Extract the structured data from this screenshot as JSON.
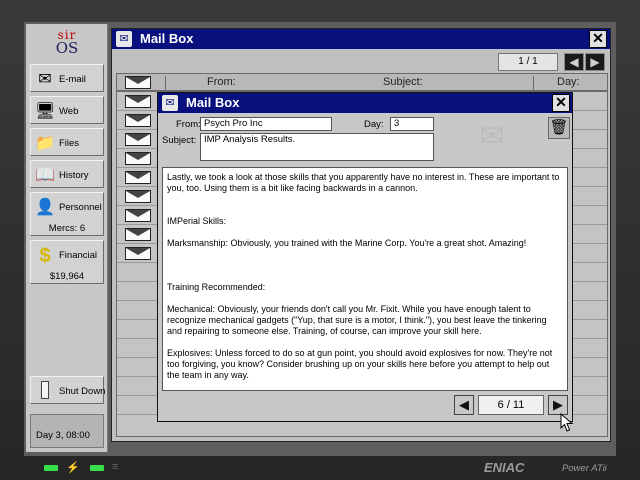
{
  "os": {
    "logo_top": "sir",
    "logo_bottom": "OS"
  },
  "sidebar": {
    "items": [
      {
        "label": "E-mail",
        "icon": "mail-icon"
      },
      {
        "label": "Web",
        "icon": "web-icon"
      },
      {
        "label": "Files",
        "icon": "folder-icon"
      },
      {
        "label": "History",
        "icon": "book-icon"
      },
      {
        "label": "Personnel",
        "icon": "person-icon",
        "sub": "Mercs: 6"
      },
      {
        "label": "Financial",
        "icon": "dollar-icon",
        "sub": "$19,964"
      },
      {
        "label": "Shut Down",
        "icon": "power-icon"
      }
    ],
    "day": "Day 3, 08:00"
  },
  "mailbox": {
    "title": "Mail Box",
    "page": "1 / 1",
    "columns": {
      "from": "From:",
      "subject": "Subject:",
      "day": "Day:"
    },
    "close": "✕"
  },
  "mail": {
    "title": "Mail Box",
    "from_label": "From:",
    "from_value": "Psych Pro Inc",
    "day_label": "Day:",
    "day_value": "3",
    "subject_label": "Subject:",
    "subject_value": "IMP Analysis Results.",
    "body": [
      "Lastly, we took a look at those skills that you apparently have no interest in. These are important to you, too. Using them is a bit like facing backwards in a cannon.",
      "IMPerial Skills:",
      "Marksmanship: Obviously, you trained with the Marine Corp. You're a great shot. Amazing!",
      "Training Recommended:",
      "Mechanical: Obviously, your friends don't call you Mr. Fixit. While you have enough talent to recognize mechanical gadgets (\"Yup, that sure is a motor, I think.\"), you best leave the tinkering and repairing to someone else. Training, of course, can improve your skill here.",
      "Explosives: Unless forced to do so at gun point, you should avoid explosives for now. They're not too forgiving, you know? Consider brushing up on your skills here before you attempt to help out the team in any way."
    ],
    "page": "6 / 11",
    "close": "✕"
  },
  "brand": {
    "name": "ENIAC",
    "model": "Power ATii"
  },
  "colors": {
    "titlebar": "#08107e",
    "led": "#37e04a",
    "logo_red": "#c00000"
  }
}
